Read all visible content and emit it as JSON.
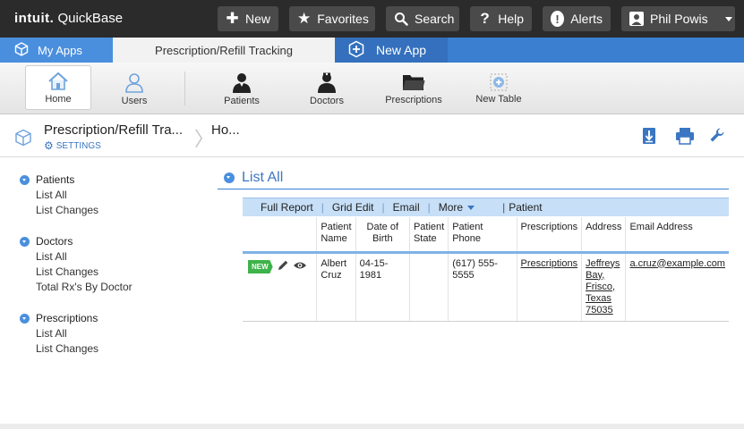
{
  "topbar": {
    "logo_brand": "intuit.",
    "logo_product": "QuickBase",
    "buttons": {
      "new": "New",
      "favorites": "Favorites",
      "search": "Search",
      "help": "Help",
      "alerts": "Alerts",
      "user": "Phil Powis"
    }
  },
  "tabs": {
    "my_apps": "My Apps",
    "active": "Prescription/Refill Tracking",
    "new_app": "New App"
  },
  "toolbar": {
    "home": "Home",
    "users": "Users",
    "patients": "Patients",
    "doctors": "Doctors",
    "prescriptions": "Prescriptions",
    "new_table": "New Table"
  },
  "breadcrumb": {
    "app_title": "Prescription/Refill Tra...",
    "settings": "SETTINGS",
    "page": "Ho..."
  },
  "sidebar": {
    "groups": [
      {
        "title": "Patients",
        "items": [
          "List All",
          "List Changes"
        ]
      },
      {
        "title": "Doctors",
        "items": [
          "List All",
          "List Changes",
          "Total Rx's By Doctor"
        ]
      },
      {
        "title": "Prescriptions",
        "items": [
          "List All",
          "List Changes"
        ]
      }
    ]
  },
  "report": {
    "title": "List All",
    "toolbar": {
      "full_report": "Full Report",
      "grid_edit": "Grid Edit",
      "email": "Email",
      "more": "More",
      "table_name": "Patient"
    },
    "columns": [
      "Patient Name",
      "Date of Birth",
      "Patient State",
      "Patient Phone",
      "Prescriptions",
      "Address",
      "Email Address"
    ],
    "rows": [
      {
        "badge": "NEW",
        "name": "Albert Cruz",
        "dob": "04-15-1981",
        "state": "",
        "phone": "(617) 555-5555",
        "prescriptions": "Prescriptions",
        "address": "Jeffreys Bay, Frisco, Texas 75035",
        "email": "a.cruz@example.com"
      }
    ]
  },
  "colors": {
    "topbar_bg": "#2b2b2b",
    "tab_blue": "#3a7fd0",
    "accent_blue": "#3a76c2",
    "new_badge": "#3eb34a"
  }
}
